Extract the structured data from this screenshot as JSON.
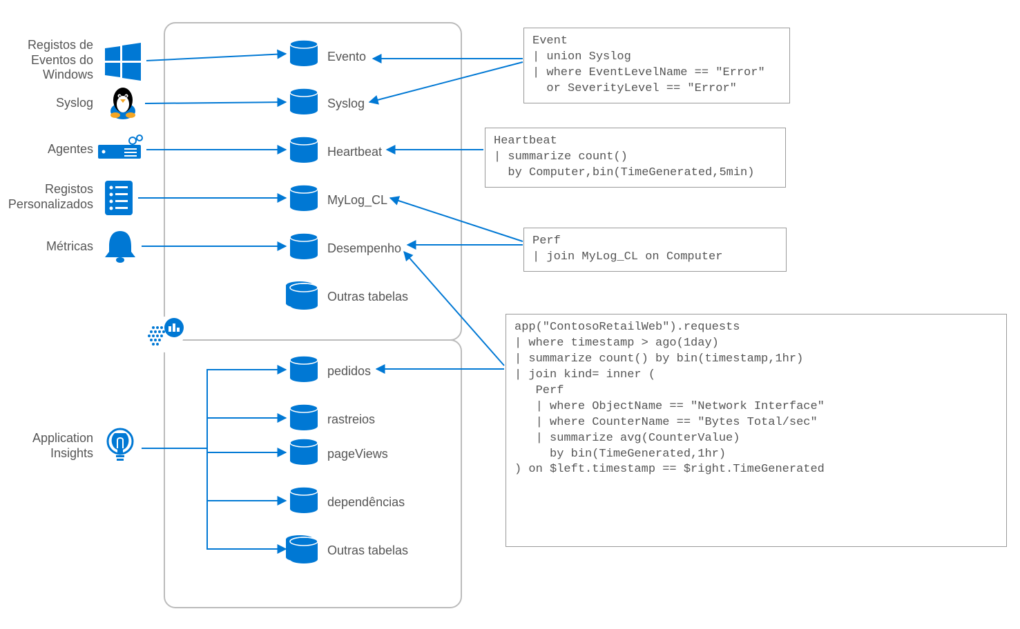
{
  "sources": {
    "windows": "Registos de\nEventos do\nWindows",
    "syslog": "Syslog",
    "agents": "Agentes",
    "custom": "Registos\nPersonalizados",
    "metrics": "Métricas",
    "appinsights": "Application\nInsights"
  },
  "tables": {
    "event": "Evento",
    "syslog": "Syslog",
    "heartbeat": "Heartbeat",
    "mylog": "MyLog_CL",
    "perf": "Desempenho",
    "other1": "Outras tabelas",
    "requests": "pedidos",
    "traces": "rastreios",
    "pageviews": "pageViews",
    "dependencies": "dependências",
    "other2": "Outras tabelas"
  },
  "queries": {
    "q1": "Event\n| union Syslog\n| where EventLevelName == \"Error\"\n  or SeverityLevel == \"Error\"",
    "q2": "Heartbeat\n| summarize count()\n  by Computer,bin(TimeGenerated,5min)",
    "q3": "Perf\n| join MyLog_CL on Computer",
    "q4": "app(\"ContosoRetailWeb\").requests\n| where timestamp > ago(1day)\n| summarize count() by bin(timestamp,1hr)\n| join kind= inner (\n   Perf\n   | where ObjectName == \"Network Interface\"\n   | where CounterName == \"Bytes Total/sec\"\n   | summarize avg(CounterValue)\n     by bin(TimeGenerated,1hr)\n) on $left.timestamp == $right.TimeGenerated"
  }
}
